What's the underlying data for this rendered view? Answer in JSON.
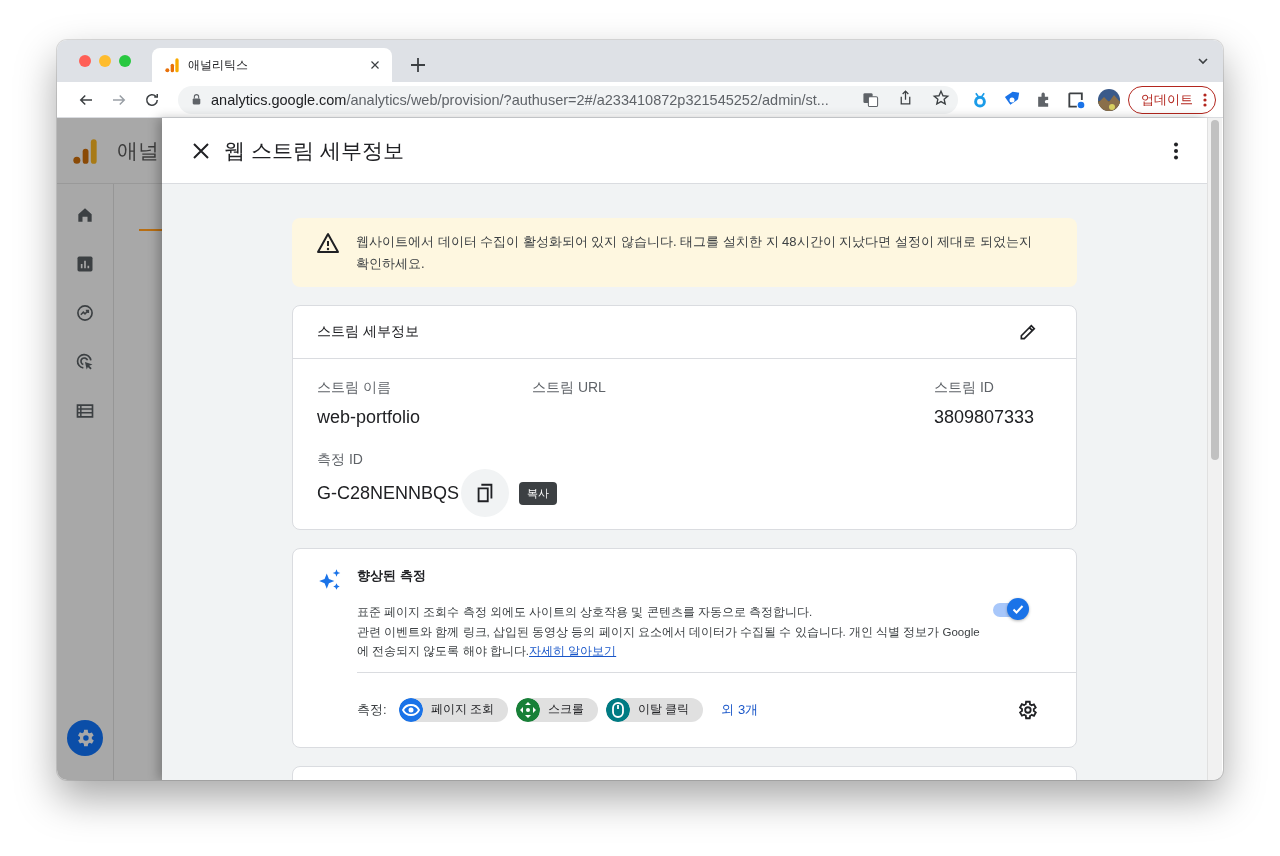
{
  "browser": {
    "tabs": [
      {
        "title": "애널리틱스",
        "selected": true
      }
    ],
    "url": {
      "host": "analytics.google.com",
      "path": "/analytics/web/provision/?authuser=2#/a233410872p321545252/admin/st..."
    },
    "update_button": "업데이트"
  },
  "app": {
    "brand": "애널"
  },
  "drawer": {
    "title": "웹 스트림 세부정보"
  },
  "warning": {
    "text": "웹사이트에서 데이터 수집이 활성화되어 있지 않습니다. 태그를 설치한 지 48시간이 지났다면 설정이 제대로 되었는지 확인하세요."
  },
  "stream_card": {
    "title": "스트림 세부정보",
    "fields": [
      {
        "label": "스트림 이름",
        "value": "web-portfolio"
      },
      {
        "label": "스트림 URL"
      },
      {
        "label": "스트림 ID",
        "value": "3809807333"
      }
    ],
    "measurement": {
      "label": "측정 ID",
      "value": "G-C28NENNBQS",
      "tooltip": "복사"
    }
  },
  "enhanced": {
    "title": "향상된 측정",
    "on": true,
    "description": "표준 페이지 조회수 측정 외에도 사이트의 상호작용 및 콘텐츠를 자동으로 측정합니다.",
    "note": "관련 이벤트와 함께 링크, 삽입된 동영상 등의 페이지 요소에서 데이터가 수집될 수 있습니다. 개인 식별 정보가 Google에 전송되지 않도록 해야 합니다.",
    "link": "자세히 알아보기",
    "events_label": "측정:",
    "events": [
      {
        "label": "페이지 조회",
        "kind": "eye",
        "color": "#1a73e8"
      },
      {
        "label": "스크롤",
        "kind": "scroll",
        "color": "#188038"
      },
      {
        "label": "이탈 클릭",
        "kind": "mouse",
        "color": "#007b83"
      }
    ],
    "more": "외 3개"
  }
}
